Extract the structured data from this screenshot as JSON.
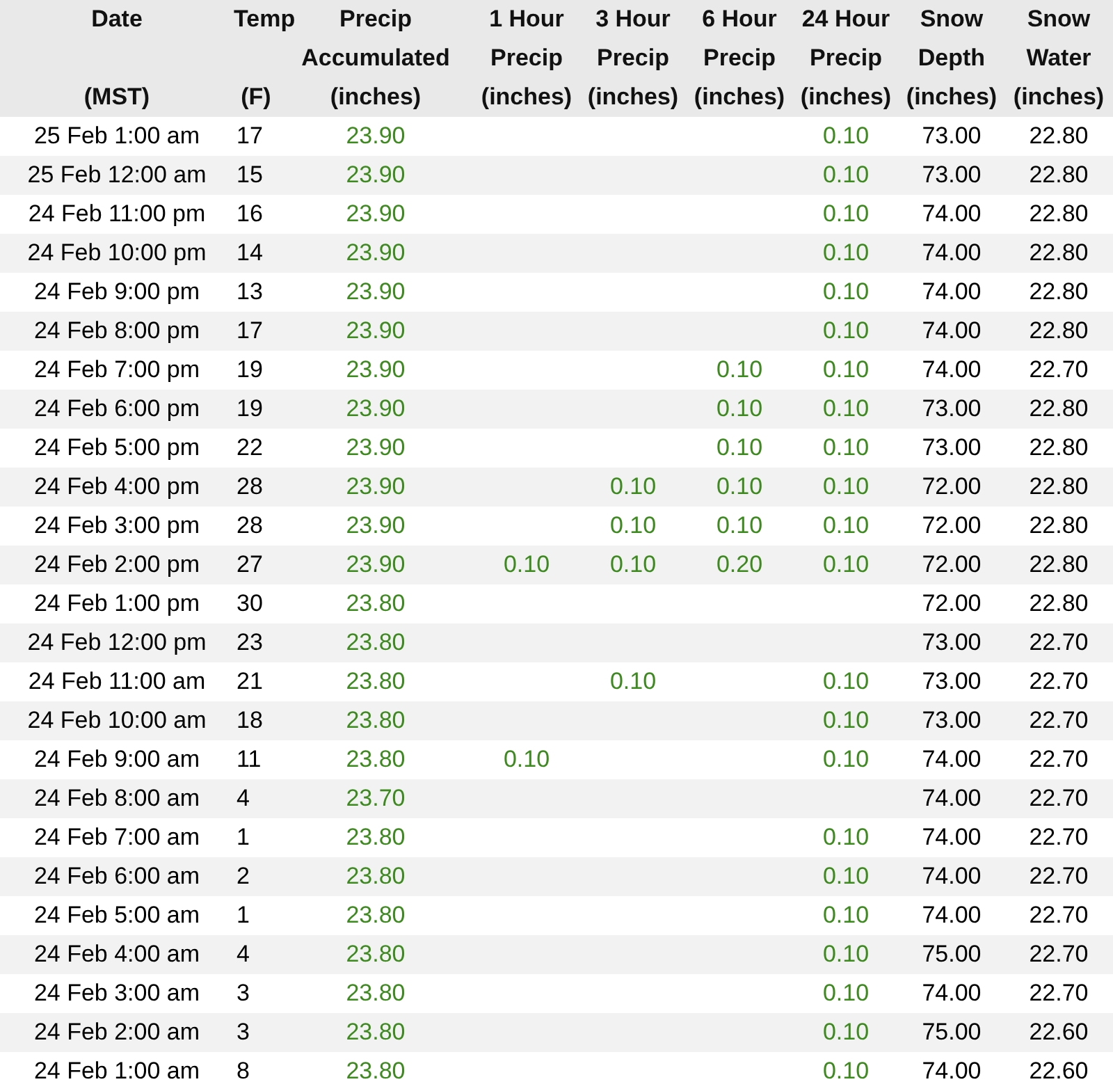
{
  "columns": [
    {
      "kind": "date",
      "top": "Date",
      "bottom": "(MST)"
    },
    {
      "kind": "temp",
      "top": "Temp",
      "bottom": "(F)"
    },
    {
      "kind": "precip",
      "top": "Precip",
      "middle": "Accumulated",
      "bottom": "(inches)"
    },
    {
      "kind": "precip",
      "top": "1 Hour",
      "middle": "Precip",
      "bottom": "(inches)"
    },
    {
      "kind": "precip",
      "top": "3 Hour",
      "middle": "Precip",
      "bottom": "(inches)"
    },
    {
      "kind": "precip",
      "top": "6 Hour",
      "middle": "Precip",
      "bottom": "(inches)"
    },
    {
      "kind": "precip",
      "top": "24 Hour",
      "middle": "Precip",
      "bottom": "(inches)"
    },
    {
      "kind": "measure",
      "top": "Snow",
      "middle": "Depth",
      "bottom": "(inches)"
    },
    {
      "kind": "measure",
      "top": "Snow",
      "middle": "Water",
      "bottom": "(inches)"
    }
  ],
  "rows": [
    [
      "25 Feb 1:00 am",
      "17",
      "23.90",
      null,
      null,
      null,
      "0.10",
      "73.00",
      "22.80"
    ],
    [
      "25 Feb 12:00 am",
      "15",
      "23.90",
      null,
      null,
      null,
      "0.10",
      "73.00",
      "22.80"
    ],
    [
      "24 Feb 11:00 pm",
      "16",
      "23.90",
      null,
      null,
      null,
      "0.10",
      "74.00",
      "22.80"
    ],
    [
      "24 Feb 10:00 pm",
      "14",
      "23.90",
      null,
      null,
      null,
      "0.10",
      "74.00",
      "22.80"
    ],
    [
      "24 Feb 9:00 pm",
      "13",
      "23.90",
      null,
      null,
      null,
      "0.10",
      "74.00",
      "22.80"
    ],
    [
      "24 Feb 8:00 pm",
      "17",
      "23.90",
      null,
      null,
      null,
      "0.10",
      "74.00",
      "22.80"
    ],
    [
      "24 Feb 7:00 pm",
      "19",
      "23.90",
      null,
      null,
      "0.10",
      "0.10",
      "74.00",
      "22.70"
    ],
    [
      "24 Feb 6:00 pm",
      "19",
      "23.90",
      null,
      null,
      "0.10",
      "0.10",
      "73.00",
      "22.80"
    ],
    [
      "24 Feb 5:00 pm",
      "22",
      "23.90",
      null,
      null,
      "0.10",
      "0.10",
      "73.00",
      "22.80"
    ],
    [
      "24 Feb 4:00 pm",
      "28",
      "23.90",
      null,
      "0.10",
      "0.10",
      "0.10",
      "72.00",
      "22.80"
    ],
    [
      "24 Feb 3:00 pm",
      "28",
      "23.90",
      null,
      "0.10",
      "0.10",
      "0.10",
      "72.00",
      "22.80"
    ],
    [
      "24 Feb 2:00 pm",
      "27",
      "23.90",
      "0.10",
      "0.10",
      "0.20",
      "0.10",
      "72.00",
      "22.80"
    ],
    [
      "24 Feb 1:00 pm",
      "30",
      "23.80",
      null,
      null,
      null,
      null,
      "72.00",
      "22.80"
    ],
    [
      "24 Feb 12:00 pm",
      "23",
      "23.80",
      null,
      null,
      null,
      null,
      "73.00",
      "22.70"
    ],
    [
      "24 Feb 11:00 am",
      "21",
      "23.80",
      null,
      "0.10",
      null,
      "0.10",
      "73.00",
      "22.70"
    ],
    [
      "24 Feb 10:00 am",
      "18",
      "23.80",
      null,
      null,
      null,
      "0.10",
      "73.00",
      "22.70"
    ],
    [
      "24 Feb 9:00 am",
      "11",
      "23.80",
      "0.10",
      null,
      null,
      "0.10",
      "74.00",
      "22.70"
    ],
    [
      "24 Feb 8:00 am",
      "4",
      "23.70",
      null,
      null,
      null,
      null,
      "74.00",
      "22.70"
    ],
    [
      "24 Feb 7:00 am",
      "1",
      "23.80",
      null,
      null,
      null,
      "0.10",
      "74.00",
      "22.70"
    ],
    [
      "24 Feb 6:00 am",
      "2",
      "23.80",
      null,
      null,
      null,
      "0.10",
      "74.00",
      "22.70"
    ],
    [
      "24 Feb 5:00 am",
      "1",
      "23.80",
      null,
      null,
      null,
      "0.10",
      "74.00",
      "22.70"
    ],
    [
      "24 Feb 4:00 am",
      "4",
      "23.80",
      null,
      null,
      null,
      "0.10",
      "75.00",
      "22.70"
    ],
    [
      "24 Feb 3:00 am",
      "3",
      "23.80",
      null,
      null,
      null,
      "0.10",
      "74.00",
      "22.70"
    ],
    [
      "24 Feb 2:00 am",
      "3",
      "23.80",
      null,
      null,
      null,
      "0.10",
      "75.00",
      "22.60"
    ],
    [
      "24 Feb 1:00 am",
      "8",
      "23.80",
      null,
      null,
      null,
      "0.10",
      "74.00",
      "22.60"
    ]
  ]
}
